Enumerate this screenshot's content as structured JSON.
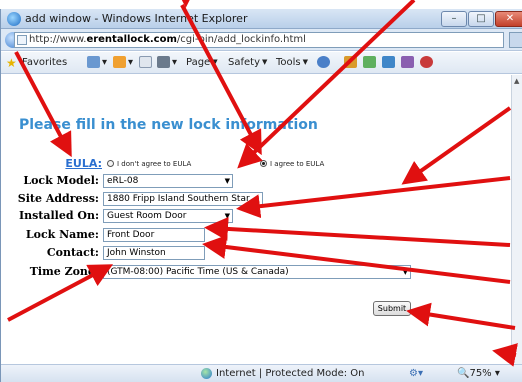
{
  "window": {
    "title": "add window - Windows Internet Explorer",
    "minimize_glyph": "–",
    "maximize_glyph": "□",
    "close_glyph": "✕"
  },
  "address_bar": {
    "url_scheme": "http://www.",
    "url_host": "erentallock.com",
    "url_path": "/cgi-bin/add_lockinfo.html"
  },
  "command_bar": {
    "favorites": "Favorites",
    "page": "Page",
    "safety": "Safety",
    "tools": "Tools"
  },
  "form": {
    "heading": "Please fill in the new lock information",
    "eula": {
      "label": "EULA:",
      "option_disagree": "I don't agree to EULA",
      "option_agree": "I agree to EULA",
      "selected": "agree"
    },
    "lock_model": {
      "label": "Lock Model:",
      "value": "eRL-08"
    },
    "site_address": {
      "label": "Site Address:",
      "value": "1880 Fripp Island Southern Star"
    },
    "installed_on": {
      "label": "Installed On:",
      "value": "Guest Room Door"
    },
    "lock_name": {
      "label": "Lock Name:",
      "value": "Front Door"
    },
    "contact": {
      "label": "Contact:",
      "value": "John Winston"
    },
    "time_zone": {
      "label": "Time Zone:",
      "value": "(GTM-08:00) Pacific Time (US & Canada)"
    },
    "submit_label": "Submit"
  },
  "status_bar": {
    "zone_text": "Internet | Protected Mode: On",
    "zoom": "75%"
  },
  "colors": {
    "annotation_arrow": "#e01010",
    "heading": "#3a8fd0",
    "eula_link": "#2a6fd0"
  }
}
